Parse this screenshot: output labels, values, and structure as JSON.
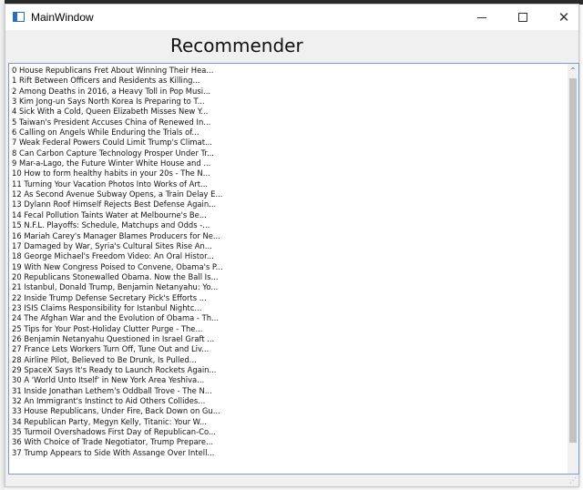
{
  "window": {
    "title": "MainWindow",
    "controls": {
      "minimize": "–",
      "maximize": "☐",
      "close": "✕"
    }
  },
  "heading": "Recommender",
  "list": {
    "items": [
      "0 House Republicans Fret About Winning Their Hea...",
      "1 Rift Between Officers and Residents as Killing...",
      "2 Among Deaths in 2016, a Heavy Toll in Pop Musi...",
      "3 Kim Jong-un Says North Korea Is Preparing to T...",
      "4 Sick With a Cold, Queen Elizabeth Misses New Y...",
      "5 Taiwan's President Accuses China of Renewed In...",
      "6 Calling on Angels While Enduring the Trials of...",
      "7 Weak Federal Powers Could Limit Trump's Climat...",
      "8 Can Carbon Capture Technology Prosper Under Tr...",
      "9 Mar-a-Lago, the Future Winter White House and ...",
      "10 How to form healthy habits in your 20s - The N...",
      "11 Turning Your Vacation Photos Into Works of Art...",
      "12 As Second Avenue Subway Opens, a Train Delay E...",
      "13 Dylann Roof Himself Rejects Best Defense Again...",
      "14 Fecal Pollution Taints Water at Melbourne's Be...",
      "15 N.F.L. Playoffs: Schedule, Matchups and Odds -...",
      "16 Mariah Carey's Manager Blames Producers for Ne...",
      "17 Damaged by War, Syria's Cultural Sites Rise An...",
      "18 George Michael's Freedom Video: An Oral Histor...",
      "19 With New Congress Poised to Convene, Obama's P...",
      "20 Republicans Stonewalled Obama. Now the Ball Is...",
      "21 Istanbul, Donald Trump, Benjamin Netanyahu: Yo...",
      "22 Inside Trump Defense Secretary Pick's Efforts ...",
      "23 ISIS Claims Responsibility for Istanbul Nightc...",
      "24 The Afghan War and the Evolution of Obama - Th...",
      "25 Tips for Your Post-Holiday Clutter Purge - The...",
      "26 Benjamin Netanyahu Questioned in Israel Graft ...",
      "27 France Lets Workers Turn Off, Tune Out and Liv...",
      "28 Airline Pilot, Believed to Be Drunk, Is Pulled...",
      "29 SpaceX Says It's Ready to Launch Rockets Again...",
      "30 A 'World Unto Itself' in New York Area Yeshiva...",
      "31 Inside Jonathan Lethem's Oddball Trove - The N...",
      "32 An Immigrant's Instinct to Aid Others Collides...",
      "33 House Republicans, Under Fire, Back Down on Gu...",
      "34 Republican Party, Megyn Kelly, Titanic: Your W...",
      "35 Turmoil Overshadows First Day of Republican-Co...",
      "36 With Choice of Trade Negotiator, Trump Prepare...",
      "37 Trump Appears to Side With Assange Over Intell..."
    ]
  },
  "scrollbar": {
    "up_arrow": "⌃"
  },
  "statusbar": {
    "grip": "⋰"
  }
}
